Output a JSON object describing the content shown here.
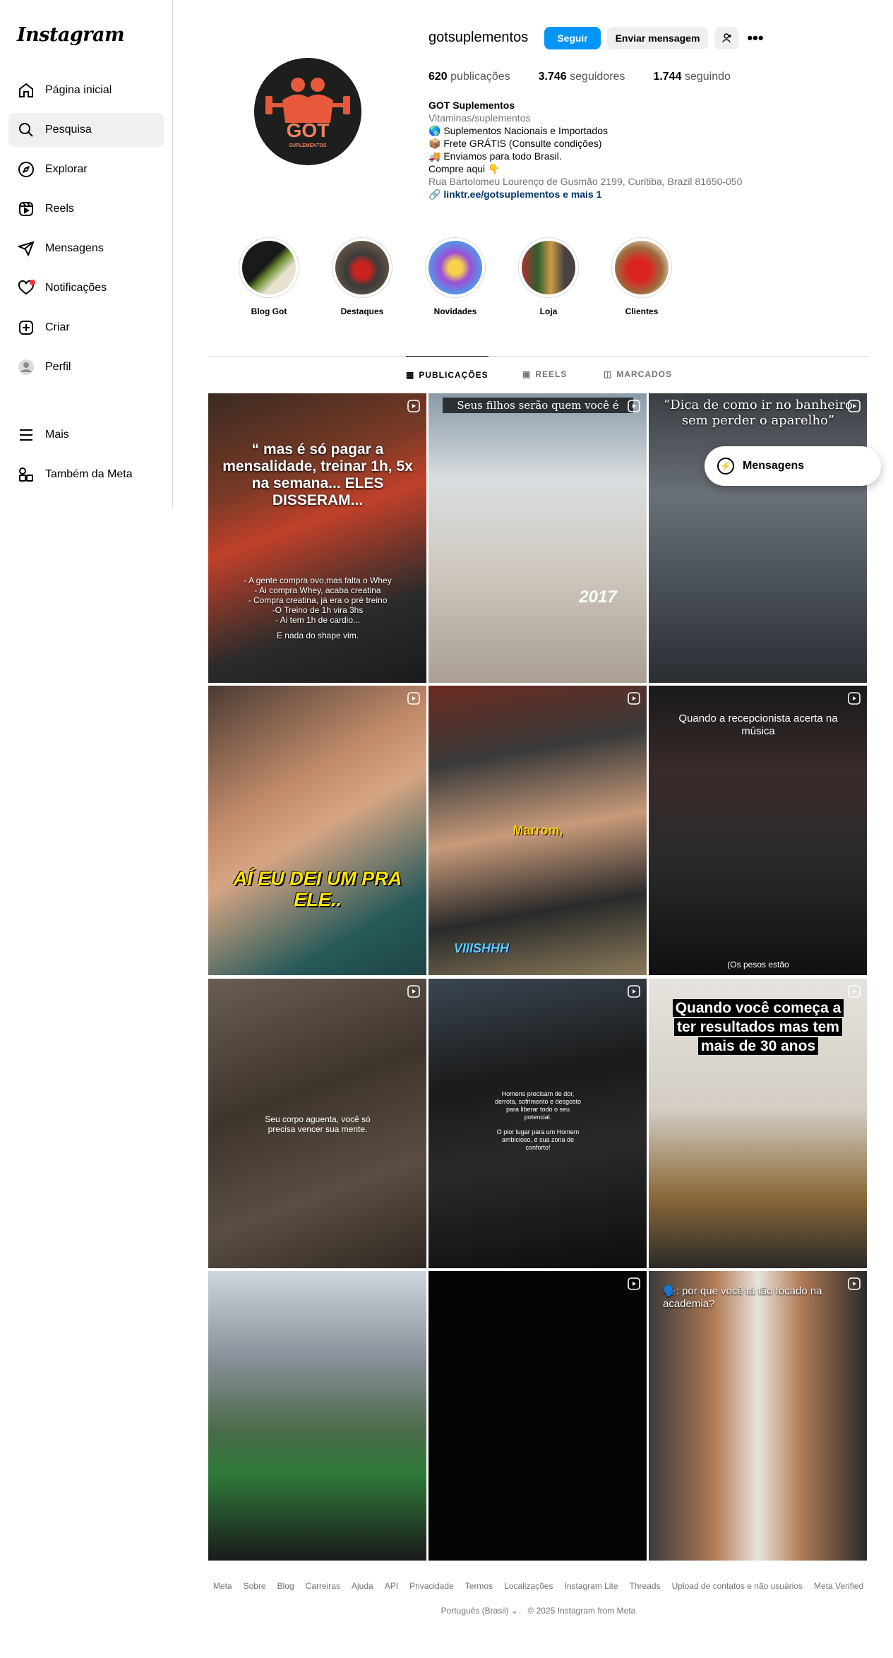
{
  "app": {
    "logo_text": "Instagram"
  },
  "sidebar": {
    "items": [
      {
        "label": "Página inicial",
        "icon": "home-icon"
      },
      {
        "label": "Pesquisa",
        "icon": "search-icon",
        "active": true
      },
      {
        "label": "Explorar",
        "icon": "compass-icon"
      },
      {
        "label": "Reels",
        "icon": "reels-icon"
      },
      {
        "label": "Mensagens",
        "icon": "send-icon"
      },
      {
        "label": "Notificações",
        "icon": "heart-icon"
      },
      {
        "label": "Criar",
        "icon": "plus-square-icon"
      },
      {
        "label": "Perfil",
        "icon": "avatar-icon"
      },
      {
        "label": "Mais",
        "icon": "menu-icon"
      },
      {
        "label": "Também da Meta",
        "icon": "meta-apps-icon"
      }
    ]
  },
  "profile": {
    "username": "gotsuplementos",
    "follow_label": "Seguir",
    "message_label": "Enviar mensagem",
    "stats": {
      "posts_count": "620",
      "posts_label": "publicações",
      "followers_count": "3.746",
      "followers_label": "seguidores",
      "following_count": "1.744",
      "following_label": "seguindo"
    },
    "bio": {
      "name": "GOT Suplementos",
      "category": "Vitaminas/suplementos",
      "line1": "🌎 Suplementos Nacionais e Importados",
      "line2": "📦 Frete GRÁTIS (Consulte condições)",
      "line3": "🚚 Enviamos para todo Brasil.",
      "line4": "Compre aqui 👇",
      "address": "Rua Bartolomeu Lourenço de Gusmão 2199, Curitiba, Brazil 81650-050",
      "link": "linktr.ee/gotsuplementos e mais 1"
    },
    "logo_letters": "GOT",
    "logo_sub": "SUPLEMENTOS"
  },
  "highlights": [
    {
      "label": "Blog Got"
    },
    {
      "label": "Destaques"
    },
    {
      "label": "Novidades"
    },
    {
      "label": "Loja"
    },
    {
      "label": "Clientes"
    }
  ],
  "tabs": [
    {
      "label": "PUBLICAÇÕES",
      "active": true
    },
    {
      "label": "REELS"
    },
    {
      "label": "MARCADOS"
    }
  ],
  "posts": {
    "p1_title": "“ mas é só pagar a mensalidade, treinar 1h, 5x na semana... ELES DISSERAM...",
    "p1_l1": "- A gente compra ovo,mas falta o Whey",
    "p1_l2": "- Ai compra Whey, acaba creatina",
    "p1_l3": "- Compra creatina, já era o pré treino",
    "p1_l4": "-O Treino de 1h vira 3hs",
    "p1_l5": "- Ai tem 1h de cardio...",
    "p1_l6": "E nada do shape vim.",
    "p2_title": "Seus filhos serão quem você é",
    "p2_year": "2017",
    "p3_title": "“Dica de como ir no banheiro sem perder o aparelho”",
    "p4_caption": "AÍ EU DEI UM PRA ELE..",
    "p5_caption": "Marrom,",
    "p5_bottom": "VIIISHHH",
    "p6_title": "Quando a recepcionista acerta na música",
    "p6_bottom": "(Os pesos estão",
    "p7_caption": "Seu corpo aguenta, você só precisa vencer sua mente.",
    "p8_caption1": "Homens precisam de dor, derrota, sofrimento e desgosto para liberar todo o seu potencial.",
    "p8_caption2": "O pior lugar para um Homem ambicioso, é sua zona de conforto!",
    "p9_caption": "Quando você começa a ter resultados mas tem mais de 30 anos",
    "p12_caption": "🗣️: por que você tá tão focado na academia?"
  },
  "floating": {
    "messages_label": "Mensagens"
  },
  "footer": {
    "links": [
      "Meta",
      "Sobre",
      "Blog",
      "Carreiras",
      "Ajuda",
      "API",
      "Privacidade",
      "Termos",
      "Localizações",
      "Instagram Lite",
      "Threads",
      "Upload de contatos e não usuários",
      "Meta Verified"
    ],
    "language": "Português (Brasil)",
    "copyright": "© 2025 Instagram from Meta"
  },
  "colors": {
    "accent": "#0095f6",
    "link": "#00376b",
    "notification": "#ff3040"
  }
}
